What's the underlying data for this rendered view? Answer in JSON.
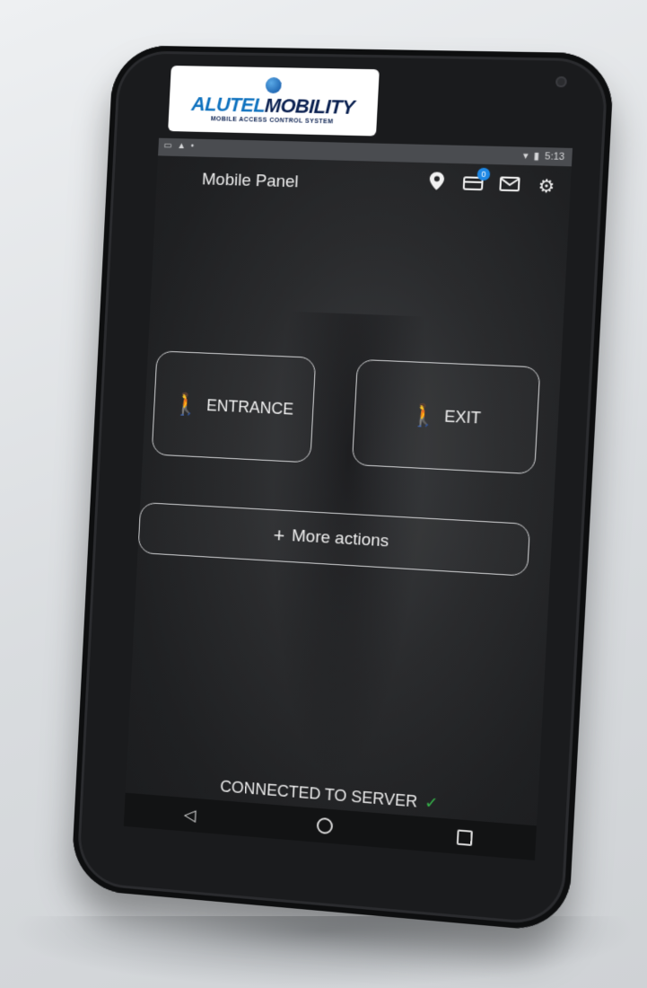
{
  "brand": {
    "name_part1": "ALUTEL",
    "name_part2": "MOBILITY",
    "tagline": "MOBILE ACCESS CONTROL SYSTEM"
  },
  "status_bar": {
    "left_icons": [
      "screenshot-icon",
      "warning-icon",
      "location-pin-icon"
    ],
    "time": "5:13"
  },
  "app_bar": {
    "title": "Mobile Panel",
    "badge_count": "0",
    "icons": [
      "location-icon",
      "cards-icon",
      "mail-icon",
      "settings-icon"
    ]
  },
  "actions": {
    "entrance_label": "ENTRANCE",
    "exit_label": "EXIT",
    "more_label": "More actions"
  },
  "connection": {
    "status_text": "CONNECTED TO SERVER"
  },
  "colors": {
    "entrance_icon": "#2fae3a",
    "exit_icon": "#2f6fe0",
    "badge": "#1e88e5",
    "connected_check": "#36b24a"
  }
}
